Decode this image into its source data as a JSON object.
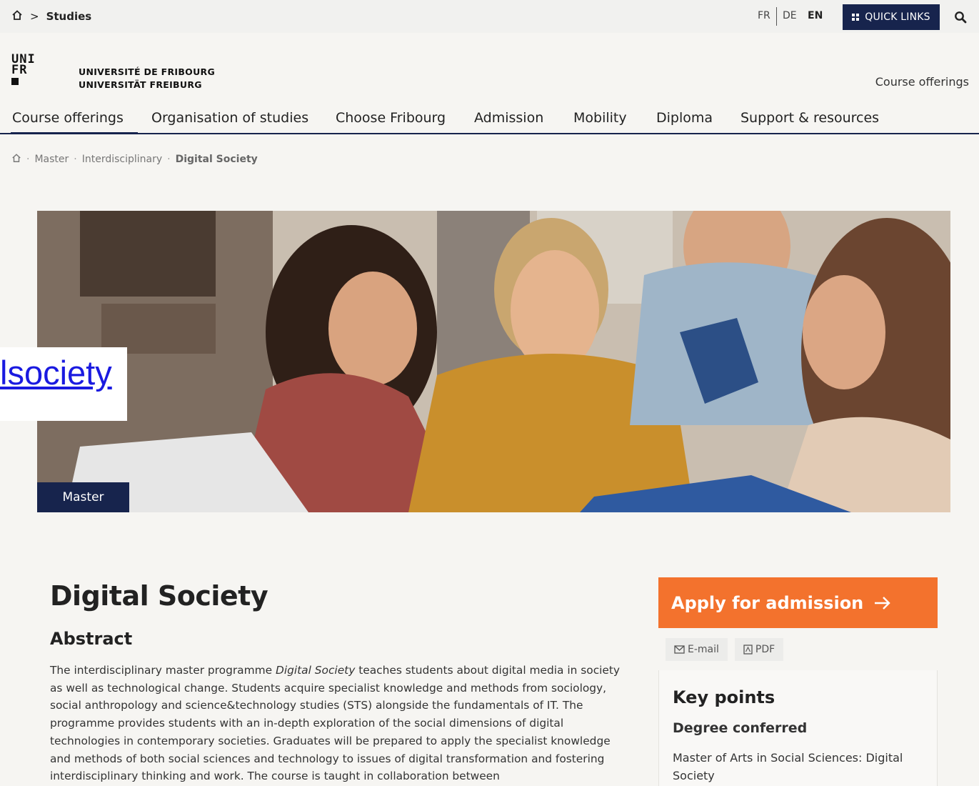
{
  "topbar": {
    "breadcrumb_current": "Studies",
    "languages": [
      {
        "label": "FR"
      },
      {
        "label": "DE"
      },
      {
        "label": "EN"
      }
    ],
    "quick_links_label": "QUICK LINKS"
  },
  "header": {
    "logo_lines": [
      "UNI",
      "FR"
    ],
    "university_name_fr": "UNIVERSITÉ DE FRIBOURG",
    "university_name_de": "UNIVERSITÄT FREIBURG",
    "section_label": "Course offerings"
  },
  "nav": {
    "items": [
      {
        "label": "Course offerings"
      },
      {
        "label": "Organisation of studies"
      },
      {
        "label": "Choose Fribourg"
      },
      {
        "label": "Admission"
      },
      {
        "label": "Mobility"
      },
      {
        "label": "Diploma"
      },
      {
        "label": "Support & resources"
      }
    ]
  },
  "breadcrumb": {
    "items": [
      "Master",
      "Interdisciplinary",
      "Digital Society"
    ]
  },
  "hero": {
    "badge": "Master",
    "broken_link_text": "lsociety"
  },
  "content": {
    "title": "Digital Society",
    "abstract_heading": "Abstract",
    "abstract_prefix": "The interdisciplinary master programme ",
    "abstract_emph": "Digital Society",
    "abstract_rest": " teaches students about digital media in society as well as technological change. Students acquire specialist knowledge and methods from sociology, social anthropology and science&technology studies (STS) alongside the fundamentals of IT. The programme provides students with an in-depth exploration of the social dimensions of digital technologies in contemporary societies. Graduates will be prepared to apply the specialist knowledge and methods of both social sciences and technology to issues of digital transformation and fostering interdisciplinary thinking and work. The course is taught in collaboration between"
  },
  "sidebar": {
    "apply_label": "Apply for admission",
    "email_label": "E-mail",
    "pdf_label": "PDF",
    "key_points_title": "Key points",
    "degree_heading": "Degree conferred",
    "degree_value": "Master of Arts in Social Sciences: Digital Society"
  },
  "colors": {
    "brand_navy": "#17244d",
    "accent_orange": "#f3722d"
  }
}
